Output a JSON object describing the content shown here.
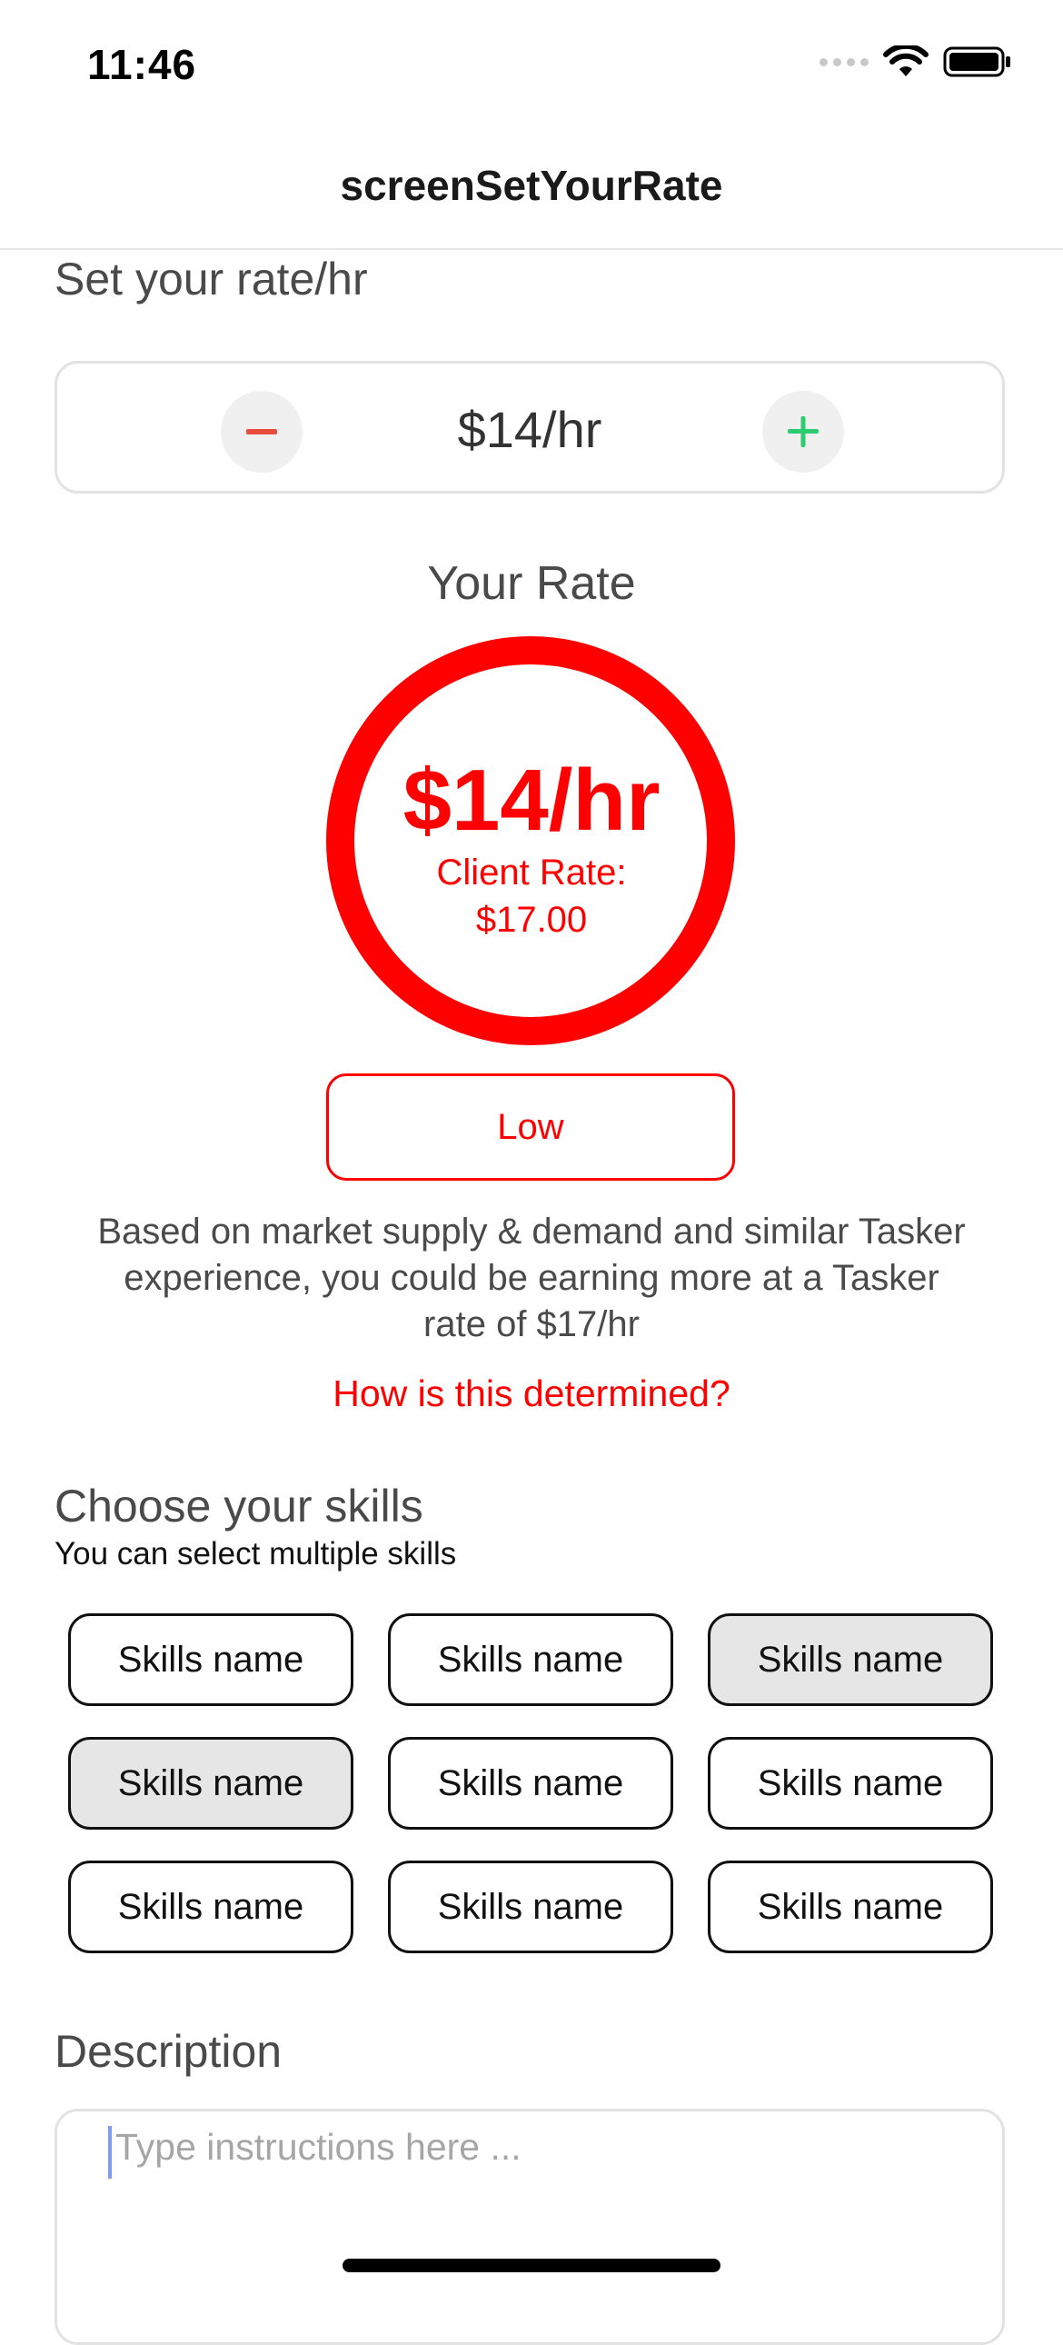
{
  "status_bar": {
    "time": "11:46"
  },
  "nav": {
    "title": "screenSetYourRate"
  },
  "rate_section": {
    "title": "Set your rate/hr",
    "value": "$14/hr",
    "decrease_symbol": "minus-icon",
    "increase_symbol": "plus-icon"
  },
  "your_rate": {
    "label": "Your Rate",
    "amount": "$14/hr",
    "client_rate_label": "Client Rate:",
    "client_rate_value": "$17.00",
    "level": "Low",
    "note": "Based on market supply & demand and similar Tasker experience, you could be earning more at a Tasker rate of $17/hr",
    "link": "How is this determined?"
  },
  "skills": {
    "title": "Choose your skills",
    "subtitle": "You can select multiple skills",
    "items": [
      {
        "label": "Skills name",
        "selected": false
      },
      {
        "label": "Skills name",
        "selected": false
      },
      {
        "label": "Skills name",
        "selected": true
      },
      {
        "label": "Skills name",
        "selected": true
      },
      {
        "label": "Skills name",
        "selected": false
      },
      {
        "label": "Skills name",
        "selected": false
      },
      {
        "label": "Skills name",
        "selected": false
      },
      {
        "label": "Skills name",
        "selected": false
      },
      {
        "label": "Skills name",
        "selected": false
      }
    ]
  },
  "description": {
    "title": "Description",
    "placeholder": "Type instructions here ..."
  },
  "colors": {
    "accent": "#ff0000",
    "plus": "#2ecc71",
    "minus": "#e74c3c",
    "chip_selected": "#e6e6e6"
  }
}
